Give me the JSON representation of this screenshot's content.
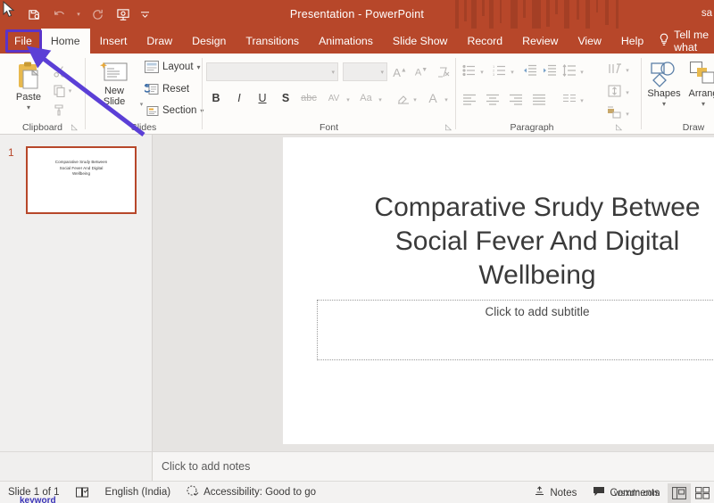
{
  "titlebar": {
    "document_title": "Presentation  -  PowerPoint",
    "right_partial_text": "sa",
    "quick_access": [
      {
        "name": "save-icon",
        "glyph": "save"
      },
      {
        "name": "undo-icon",
        "glyph": "undo"
      },
      {
        "name": "undo-dropdown-icon",
        "glyph": "chevron"
      },
      {
        "name": "redo-icon",
        "glyph": "redo"
      },
      {
        "name": "start-slideshow-icon",
        "glyph": "slideshow"
      },
      {
        "name": "customize-qat-icon",
        "glyph": "chevron"
      }
    ]
  },
  "ribbon_tabs": {
    "file": "File",
    "items": [
      {
        "label": "Home",
        "active": true
      },
      {
        "label": "Insert",
        "active": false
      },
      {
        "label": "Draw",
        "active": false
      },
      {
        "label": "Design",
        "active": false
      },
      {
        "label": "Transitions",
        "active": false
      },
      {
        "label": "Animations",
        "active": false
      },
      {
        "label": "Slide Show",
        "active": false
      },
      {
        "label": "Record",
        "active": false
      },
      {
        "label": "Review",
        "active": false
      },
      {
        "label": "View",
        "active": false
      },
      {
        "label": "Help",
        "active": false
      }
    ],
    "tell_me": "Tell me what"
  },
  "ribbon": {
    "clipboard": {
      "label": "Clipboard",
      "paste": "Paste",
      "cut_icon": "scissors-icon",
      "copy_icon": "copy-icon",
      "format_painter_icon": "format-painter-icon"
    },
    "slides": {
      "label": "Slides",
      "new_slide": "New\nSlide",
      "new_slide_line1": "New",
      "new_slide_line2": "Slide",
      "layout": "Layout",
      "reset": "Reset",
      "section": "Section"
    },
    "font": {
      "label": "Font",
      "font_name_value": "",
      "font_size_value": "",
      "grow_font": "A",
      "shrink_font": "A",
      "clear_formatting_icon": "clear-formatting-icon",
      "bold": "B",
      "italic": "I",
      "underline": "U",
      "shadow": "S",
      "strikethrough": "abc",
      "char_spacing": "AV",
      "change_case": "Aa",
      "highlight_icon": "text-highlight-icon",
      "font_color": "A"
    },
    "paragraph": {
      "label": "Paragraph",
      "bullets_icon": "bullets-icon",
      "numbering_icon": "numbering-icon",
      "decrease_indent_icon": "decrease-indent-icon",
      "increase_indent_icon": "increase-indent-icon",
      "line_spacing_icon": "line-spacing-icon",
      "align_left_icon": "align-left-icon",
      "align_center_icon": "align-center-icon",
      "align_right_icon": "align-right-icon",
      "justify_icon": "justify-icon",
      "columns_icon": "columns-icon",
      "text_direction_icon": "text-direction-icon",
      "align_text_icon": "align-text-icon",
      "smartart_icon": "convert-to-smartart-icon"
    },
    "drawing": {
      "label": "Draw",
      "shapes": "Shapes",
      "arrange": "Arrang"
    }
  },
  "slide_panel": {
    "slide_number": "1",
    "thumb_title_line1": "Comparative Srudy Between",
    "thumb_title_line2": "Social Fever And Digital",
    "thumb_title_line3": "Wellbeing"
  },
  "slide": {
    "title_line1": "Comparative Srudy Betwee",
    "title_line2": "Social Fever And Digital",
    "title_line3": "Wellbeing",
    "subtitle_placeholder": "Click to add subtitle"
  },
  "notes": {
    "placeholder": "Click to add notes"
  },
  "statusbar": {
    "slide_count": "Slide 1 of 1",
    "language": "English (India)",
    "accessibility": "Accessibility: Good to go",
    "notes_button": "Notes",
    "comments_button": "Comments",
    "normal_view_icon": "normal-view-icon",
    "sorter_view_icon": "slide-sorter-icon"
  },
  "overlay": {
    "watermark": "wsxdn.com",
    "keyword_peek": "keyword",
    "highlight_color": "#5b34c8",
    "arrow_color": "#5b3fd6"
  },
  "colors": {
    "brand": "#b7472a",
    "ribbon_bg": "#fdfcfa",
    "canvas_bg": "#e6e4e2"
  }
}
